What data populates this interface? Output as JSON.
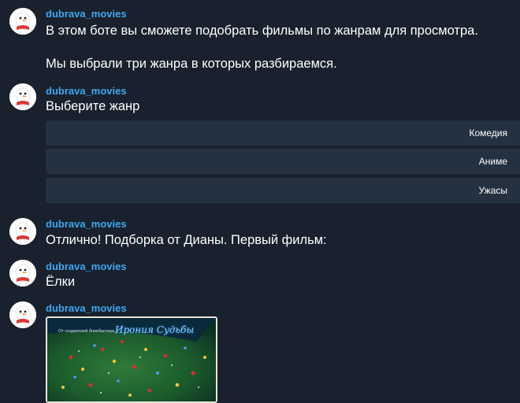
{
  "bot": {
    "name": "dubrava_movies",
    "name_color": "#3fa7f0"
  },
  "messages": [
    {
      "sender": "dubrava_movies",
      "lines": [
        "В этом боте вы сможете подобрать фильмы по жанрам для просмотра.",
        "",
        "Мы выбрали три жанра в которых разбираемся."
      ]
    },
    {
      "sender": "dubrava_movies",
      "lines": [
        "Выберите жанр"
      ],
      "keyboard": [
        "Комедия",
        "Аниме",
        "Ужасы"
      ]
    },
    {
      "sender": "dubrava_movies",
      "lines": [
        "Отлично! Подборка от Дианы. Первый фильм:"
      ]
    },
    {
      "sender": "dubrava_movies",
      "lines": [
        "Ёлки"
      ]
    },
    {
      "sender": "dubrava_movies",
      "photo": {
        "caption_top": "От создателей блокбастера",
        "brand": "Ирония Судьбы"
      }
    }
  ],
  "avatar_icon": "snowman-avatar-icon",
  "colors": {
    "background": "#18212d",
    "button": "#243140",
    "text": "#ffffff"
  }
}
